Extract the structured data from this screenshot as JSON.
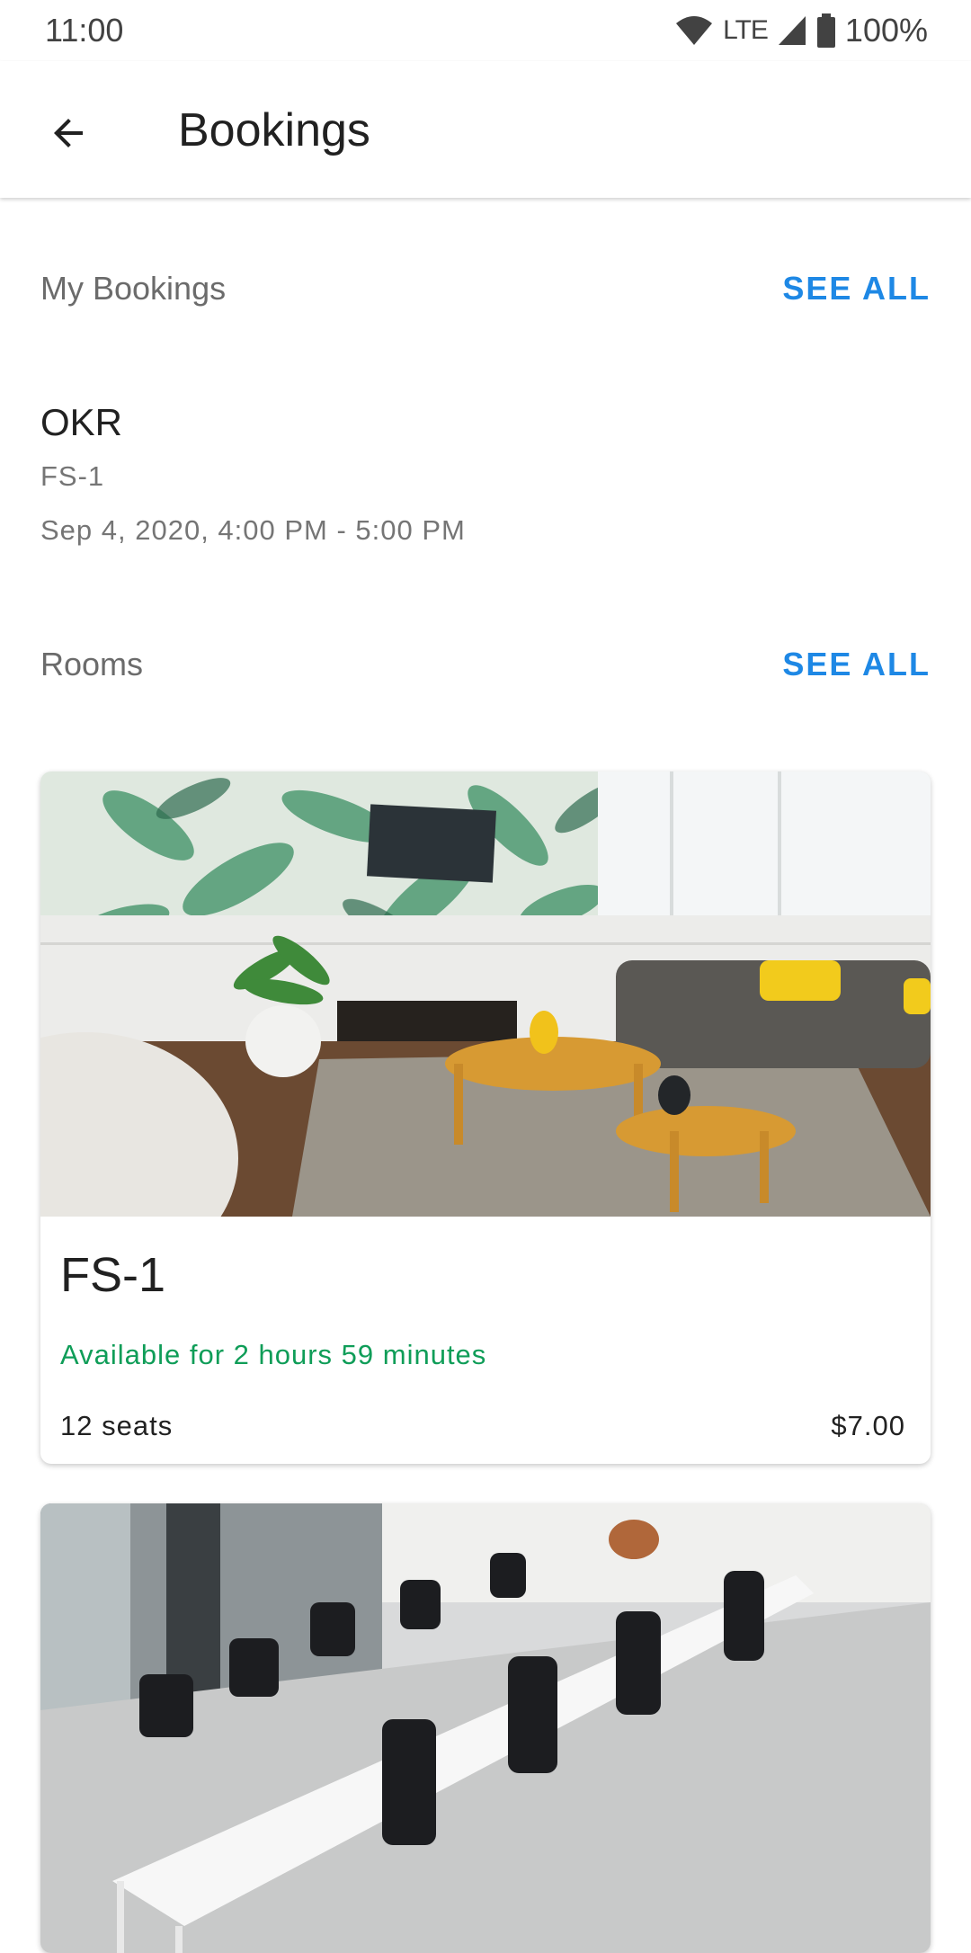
{
  "status_bar": {
    "time": "11:00",
    "network": "LTE",
    "battery": "100%"
  },
  "app_bar": {
    "title": "Bookings",
    "back_icon": "arrow-back-icon"
  },
  "my_bookings": {
    "title": "My Bookings",
    "see_all": "SEE ALL",
    "items": [
      {
        "name": "OKR",
        "room": "FS-1",
        "time": "Sep 4, 2020, 4:00 PM - 5:00 PM"
      }
    ]
  },
  "rooms": {
    "title": "Rooms",
    "see_all": "SEE ALL",
    "items": [
      {
        "name": "FS-1",
        "availability": "Available for 2 hours 59 minutes",
        "seats": "12 seats",
        "price": "$7.00"
      }
    ]
  },
  "colors": {
    "accent": "#1e88e5",
    "available": "#0f9d58"
  }
}
